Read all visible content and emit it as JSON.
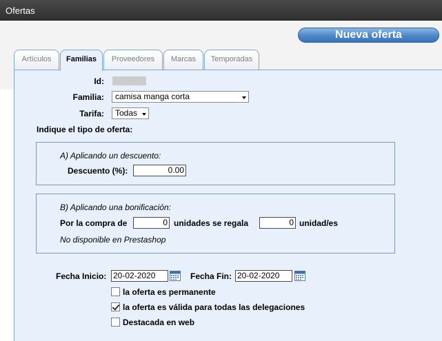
{
  "window": {
    "title": "Ofertas"
  },
  "toolbar": {
    "new_offer_label": "Nueva oferta"
  },
  "tabs": [
    {
      "label": "Artículos",
      "active": false
    },
    {
      "label": "Familias",
      "active": true
    },
    {
      "label": "Proveedores",
      "active": false
    },
    {
      "label": "Marcas",
      "active": false
    },
    {
      "label": "Temporadas",
      "active": false
    }
  ],
  "form": {
    "id_label": "Id:",
    "id_value": "",
    "familia_label": "Familia:",
    "familia_value": "camisa manga corta",
    "tarifa_label": "Tarifa:",
    "tarifa_value": "Todas",
    "offer_type_heading": "Indique el tipo de oferta:"
  },
  "discount": {
    "title": "A) Aplicando un descuento:",
    "label": "Descuento (%):",
    "value": "0.00"
  },
  "bonus": {
    "title": "B) Aplicando una bonificación:",
    "buy_label": "Por la compra de",
    "buy_value": "0",
    "units_label": "unidades se regala",
    "gift_value": "0",
    "gift_label": "unidad/es",
    "note": "No disponible en Prestashop"
  },
  "dates": {
    "start_label": "Fecha Inicio:",
    "start_value": "20-02-2020",
    "end_label": "Fecha Fin:",
    "end_value": "20-02-2020"
  },
  "options": [
    {
      "label": "la oferta es permanente",
      "checked": false
    },
    {
      "label": "la oferta es válida para todas las delegaciones",
      "checked": true
    },
    {
      "label": "Destacada en web",
      "checked": false
    }
  ],
  "colors": {
    "accent": "#4d87c8",
    "panel_bg": "#e8f1fb",
    "titlebar": "#3a3a3a"
  }
}
